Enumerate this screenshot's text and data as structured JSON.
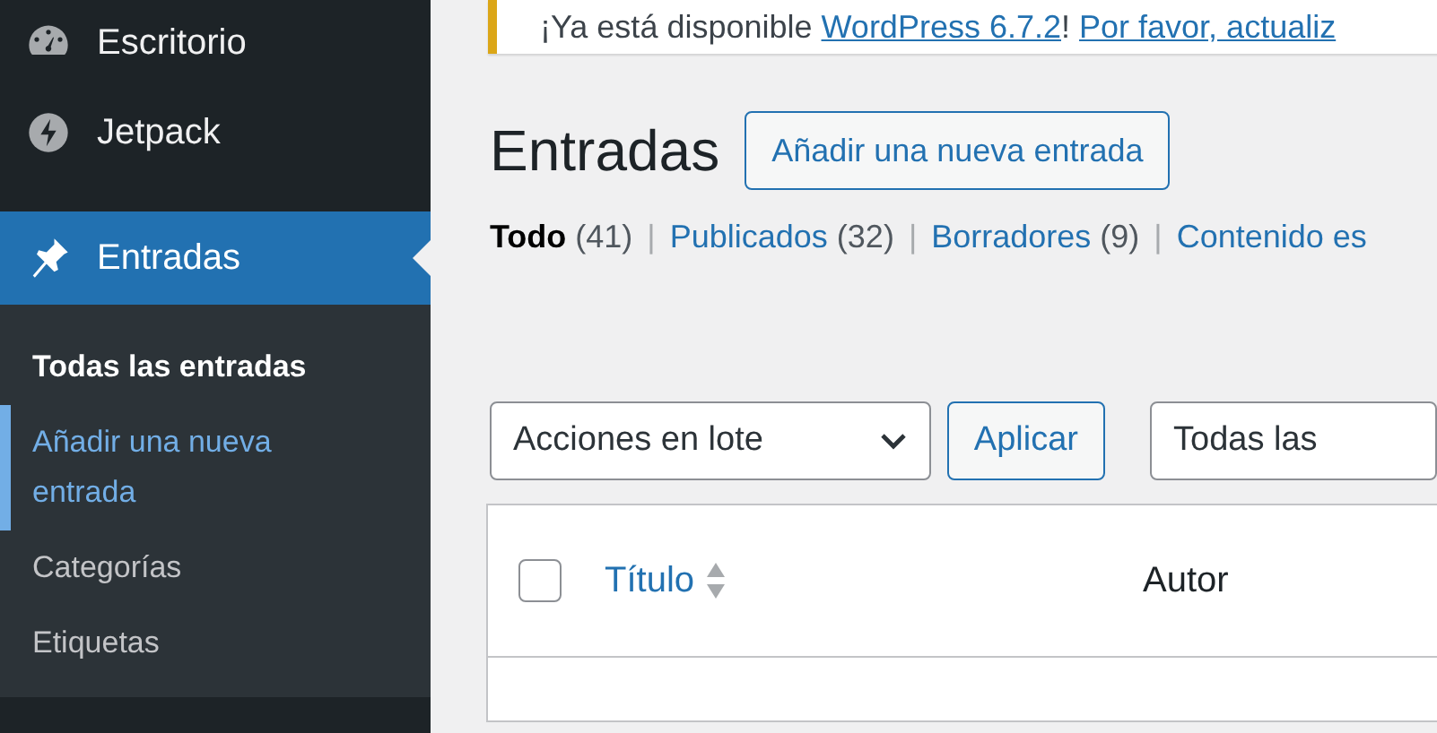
{
  "sidebar": {
    "items": [
      {
        "label": "Escritorio",
        "selected": false
      },
      {
        "label": "Jetpack",
        "selected": false
      },
      {
        "label": "Entradas",
        "selected": true
      }
    ],
    "submenu": [
      {
        "label": "Todas las entradas",
        "selected": true,
        "highlighted": false
      },
      {
        "label": "Añadir una nueva entrada",
        "selected": false,
        "highlighted": true
      },
      {
        "label": "Categorías",
        "selected": false,
        "highlighted": false
      },
      {
        "label": "Etiquetas",
        "selected": false,
        "highlighted": false
      }
    ]
  },
  "notice": {
    "text": "¡Ya está disponible",
    "link": "WordPress 6.7.2",
    "sep": "!",
    "action": "Por favor, actualiz"
  },
  "page_title": "Entradas",
  "add_button": "Añadir una nueva entrada",
  "filters": [
    {
      "label": "Todo",
      "count": "(41)",
      "selected": true
    },
    {
      "separator": "|",
      "label": "Publicados",
      "count": "(32)",
      "selected": false
    },
    {
      "separator": "|",
      "label": "Borradores",
      "count": "(9)",
      "selected": false
    },
    {
      "separator": "|",
      "label": "Contenido es",
      "selected": false
    }
  ],
  "bulk_actions": {
    "value": "Acciones en lote"
  },
  "apply_button": "Aplicar",
  "date_filter": {
    "value": "Todas las"
  },
  "table": {
    "select_all": {
      "checked": false
    },
    "columns": [
      {
        "label": "Título",
        "sortable": true
      },
      {
        "label": "Autor",
        "sortable": false
      }
    ]
  }
}
